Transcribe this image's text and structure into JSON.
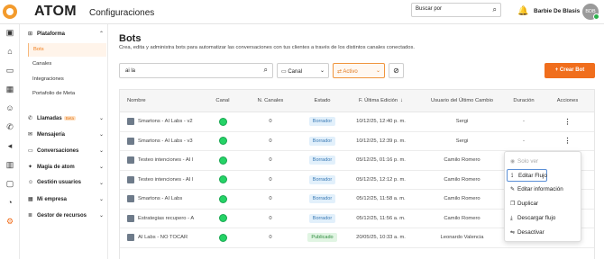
{
  "topbar": {
    "brand": "ATOM",
    "section": "Configuraciones",
    "search_placeholder": "Buscar por",
    "user_name": "Barbie De Blasis",
    "avatar_initials": "BDB"
  },
  "sidebar": {
    "plataforma": "Plataforma",
    "plataforma_items": [
      "Bots",
      "Canales",
      "Integraciones",
      "Portafolio de Meta"
    ],
    "llamadas": "Llamadas",
    "beta": "Beta",
    "mensajeria": "Mensajería",
    "conversaciones": "Conversaciones",
    "magia": "Magia de atom",
    "gestion_usuarios": "Gestión usuarios",
    "empresa": "Mi empresa",
    "recursos": "Gestor de recursos"
  },
  "page": {
    "title": "Bots",
    "description": "Crea, edita y administra bots para automatizar las conversaciones con tus clientes a través de los distintos canales conectados.",
    "search_value": "ai la",
    "canal_filter": "Canal",
    "estado_filter": "Activo",
    "create_button": "+ Crear Bot"
  },
  "table": {
    "headers": {
      "nombre": "Nombre",
      "canal": "Canal",
      "n_canales": "N. Canales",
      "estado": "Estado",
      "fecha": "F. Última Edición",
      "usuario": "Usuario del Último Cambio",
      "duracion": "Duración",
      "acciones": "Acciones"
    },
    "rows": [
      {
        "name": "Smartons - AI Labs - v2",
        "n": "0",
        "status": "Borrador",
        "date": "10/12/25, 12:40 p. m.",
        "user": "Sergi",
        "dur": "-"
      },
      {
        "name": "Smartons - AI Labs - v3",
        "n": "0",
        "status": "Borrador",
        "date": "10/12/25, 12:39 p. m.",
        "user": "Sergi",
        "dur": "-"
      },
      {
        "name": "Testeo intenciones - AI l",
        "n": "0",
        "status": "Borrador",
        "date": "05/12/25, 01:16 p. m.",
        "user": "Camilo Romero",
        "dur": ""
      },
      {
        "name": "Testeo intenciones - AI l",
        "n": "0",
        "status": "Borrador",
        "date": "05/12/25, 12:12 p. m.",
        "user": "Camilo Romero",
        "dur": ""
      },
      {
        "name": "Smartons - AI Labs",
        "n": "0",
        "status": "Borrador",
        "date": "05/12/25, 11:58 a. m.",
        "user": "Camilo Romero",
        "dur": ""
      },
      {
        "name": "Estrategias recupero - A",
        "n": "0",
        "status": "Borrador",
        "date": "05/12/25, 11:56 a. m.",
        "user": "Camilo Romero",
        "dur": ""
      },
      {
        "name": "AI Labs - NO TOCAR",
        "n": "0",
        "status": "Publicado",
        "date": "20/05/25, 10:33 a. m.",
        "user": "Leonardo Valencia",
        "dur": ""
      }
    ]
  },
  "menu": {
    "items": [
      "Solo ver",
      "Editar Flujo",
      "Editar información",
      "Duplicar",
      "Descargar flujo",
      "Desactivar"
    ]
  },
  "colors": {
    "accent": "#f06e1d",
    "whatsapp": "#25d366",
    "draft": "#3a7ab5",
    "published": "#2e8b3e"
  }
}
